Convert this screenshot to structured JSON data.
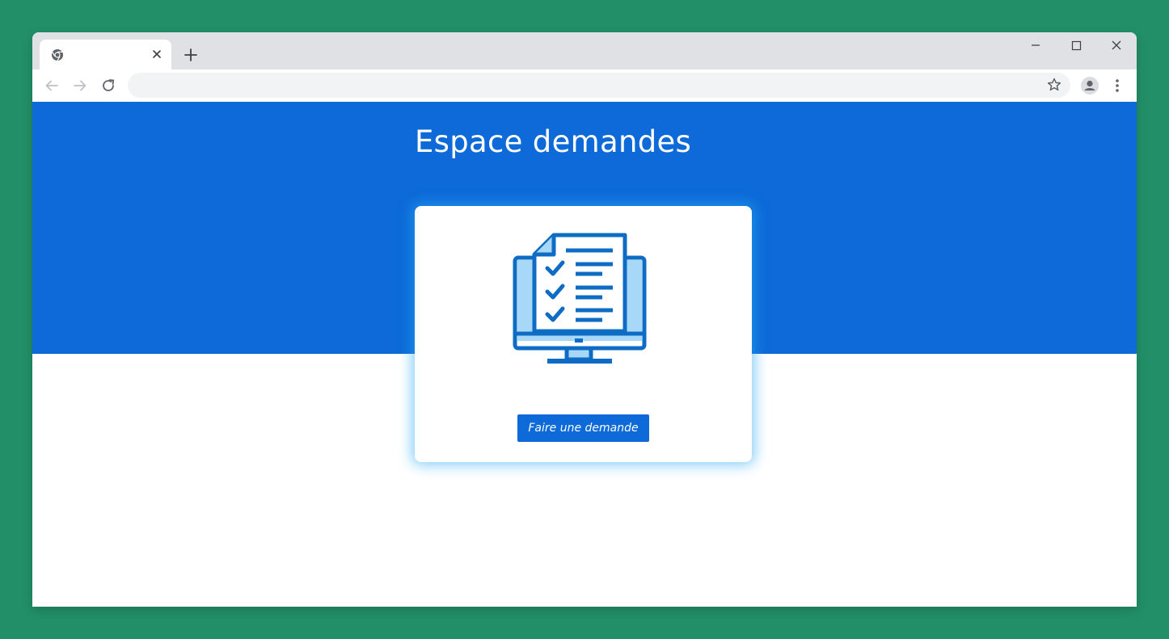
{
  "browser": {
    "tab": {
      "title": "",
      "favicon_icon": "chrome-icon",
      "close_icon": "close-icon"
    },
    "new_tab_icon": "plus-icon",
    "window_controls": [
      "minimize-icon",
      "maximize-icon",
      "close-icon"
    ],
    "toolbar": {
      "back_icon": "arrow-left-icon",
      "forward_icon": "arrow-right-icon",
      "reload_icon": "reload-icon",
      "address_value": "",
      "bookmark_icon": "star-icon",
      "profile_icon": "account-icon",
      "menu_icon": "kebab-menu-icon"
    }
  },
  "page": {
    "title": "Espace demandes",
    "card": {
      "illustration_icon": "checklist-monitor-icon",
      "button_label": "Faire une demande"
    }
  },
  "colors": {
    "background": "#228f68",
    "hero": "#0d6ad8",
    "button": "#0d6ad8",
    "illustration": "#0f6cc4",
    "illustration_light": "#a8d8f8",
    "card_glow": "#28aaf5"
  }
}
